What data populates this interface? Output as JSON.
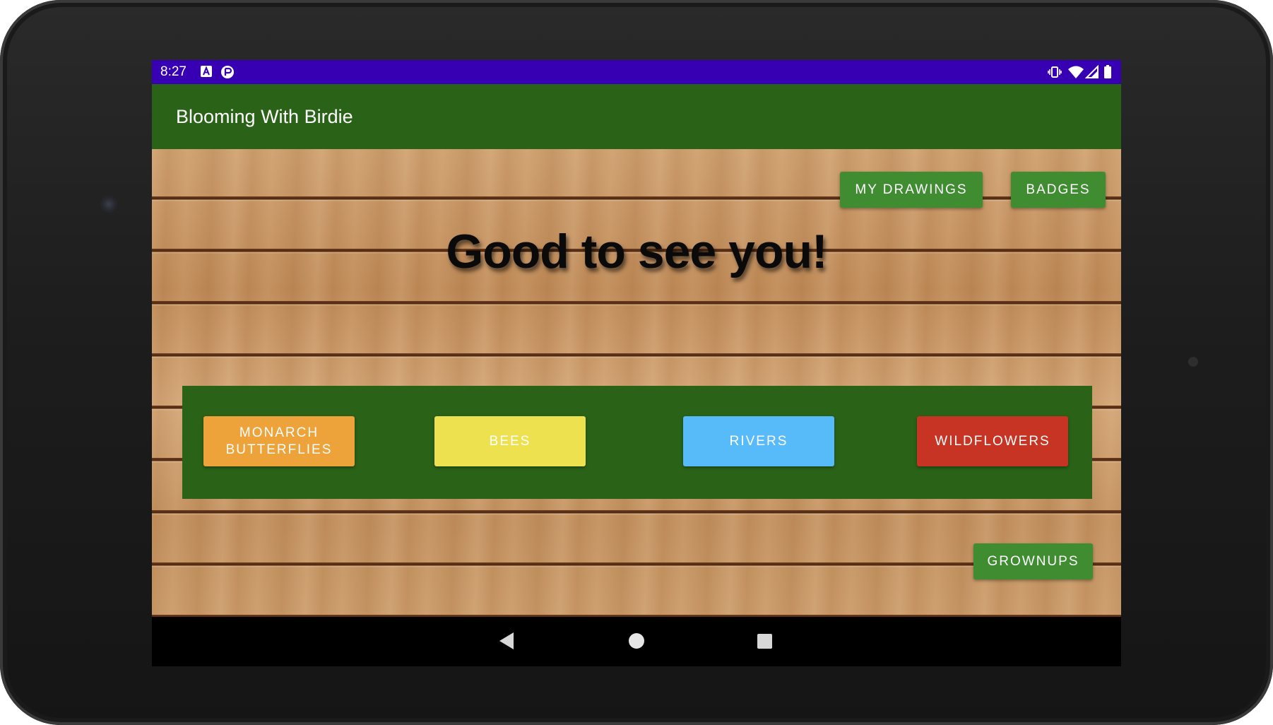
{
  "status_bar": {
    "time": "8:27",
    "left_icons": [
      "a-notification-icon",
      "media-notification-icon"
    ],
    "right_icons": [
      "vibrate-icon",
      "wifi-icon",
      "signal-icon",
      "battery-icon"
    ],
    "background": "#3700b3"
  },
  "app_bar": {
    "title": "Blooming With Birdie",
    "background": "#2a6218"
  },
  "top_actions": {
    "my_drawings_label": "MY DRAWINGS",
    "badges_label": "BADGES"
  },
  "headline": "Good to see you!",
  "topics": [
    {
      "label": "MONARCH BUTTERFLIES",
      "color": "#eea23a"
    },
    {
      "label": "BEES",
      "color": "#eee150"
    },
    {
      "label": "RIVERS",
      "color": "#58bbf9"
    },
    {
      "label": "WILDFLOWERS",
      "color": "#c73424"
    }
  ],
  "bottom_action": {
    "grownups_label": "GROWNUPS"
  },
  "nav_bar": {
    "icons": [
      "back-icon",
      "home-icon",
      "recents-icon"
    ]
  }
}
